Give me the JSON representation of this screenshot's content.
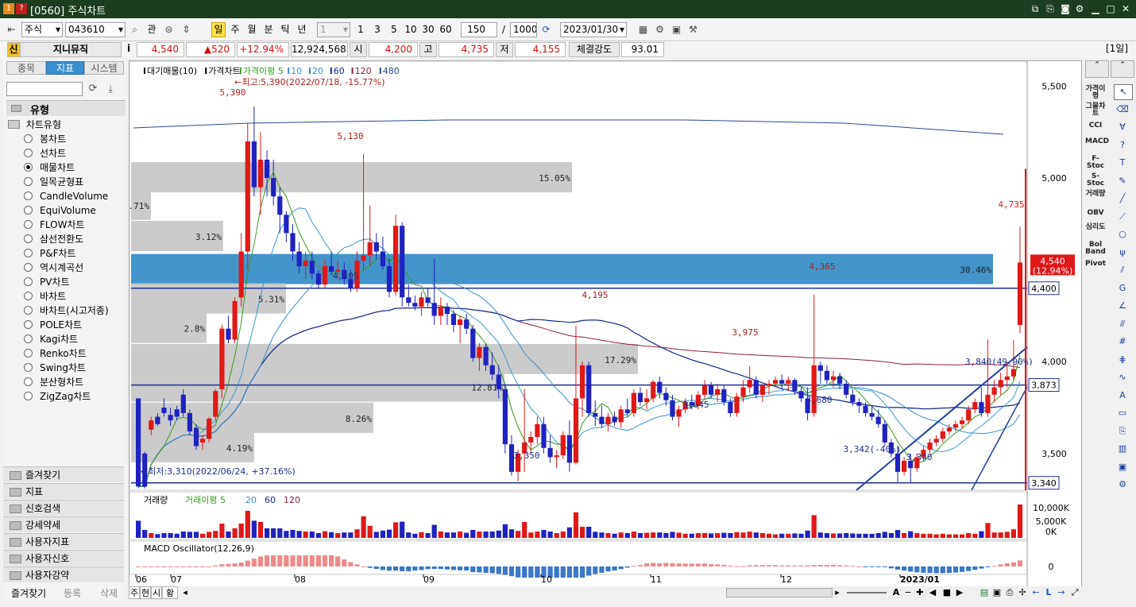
{
  "window": {
    "title": "[0560] 주식차트",
    "icon_1": "1",
    "icon_2": "?"
  },
  "toolbar": {
    "market": "주식",
    "code": "043610",
    "btn_watch": "관",
    "periods": [
      "일",
      "주",
      "월",
      "분",
      "틱",
      "년"
    ],
    "interval_value": "1",
    "quick_intervals": [
      "1",
      "3",
      "5",
      "10",
      "30",
      "60"
    ],
    "count": "150",
    "separator": "/",
    "max_count": "1000",
    "date": "2023/01/30"
  },
  "price_row": {
    "badge": "신",
    "name": "지니뮤직",
    "info": "i",
    "price": "4,540",
    "change": "▲520",
    "change_pct": "+12.94%",
    "volume": "12,924,568",
    "open_label": "시",
    "open": "4,200",
    "high_label": "고",
    "high": "4,735",
    "low_label": "저",
    "low": "4,155",
    "strength_label": "체결강도",
    "strength": "93.01",
    "period_tag": "[1일]"
  },
  "left_panel": {
    "tabs": [
      "종목",
      "지표",
      "시스템"
    ],
    "section_title": "유형",
    "group_title": "차트유형",
    "chart_types": [
      "봉차트",
      "선차트",
      "매물차트",
      "일목균형표",
      "CandleVolume",
      "EquiVolume",
      "FLOW차트",
      "삼선전환도",
      "P&F차트",
      "역시계곡선",
      "PV차트",
      "바차트",
      "바차트(시고저종)",
      "POLE차트",
      "Kagi차트",
      "Renko차트",
      "Swing차트",
      "분산형차트",
      "ZigZag차트"
    ],
    "selected_index": 2,
    "accordions": [
      "즐겨찾기",
      "지표",
      "신호검색",
      "강세약세",
      "사용자지표",
      "사용자신호",
      "사용자강약"
    ],
    "footer": [
      "즐겨찾기",
      "등록",
      "삭제"
    ]
  },
  "right_toolbar": {
    "indicator_buttons": [
      "가격이평",
      "그물차트",
      "CCI",
      "MACD",
      "F-Stoc",
      "S-Stoc",
      "거래량",
      "OBV",
      "심리도",
      "Bol Band",
      "Pivot"
    ],
    "tool_icons": [
      "cursor-icon",
      "eraser-icon",
      "all-icon",
      "help-icon",
      "text-icon",
      "pen-icon",
      "line-icon",
      "trendline-icon",
      "circle-icon",
      "fib-icon",
      "channel-icon",
      "gann-icon",
      "angle-icon",
      "parallel-icon",
      "cycle-icon",
      "speed-icon",
      "wave-icon",
      "auto-icon",
      "window-icon",
      "copy-icon",
      "chart-icon",
      "save-icon",
      "setting-icon"
    ]
  },
  "bottom_bar": {
    "tabs": [
      "주",
      "현",
      "시",
      "황"
    ]
  },
  "chart_data": {
    "type": "candlestick",
    "legend_price": [
      "대기매물(10)",
      "가격차트",
      "가격이평 5",
      "10",
      "20",
      "60",
      "120",
      "480"
    ],
    "legend_price_colors": [
      "#000000",
      "#000000",
      "#3a9a20",
      "#3a8fd0",
      "#3a8fd0",
      "#102a8a",
      "#8a2040",
      "#2a4a8a"
    ],
    "legend_volume": [
      "거래량",
      "거래이평 5",
      "20",
      "60",
      "120"
    ],
    "legend_macd": [
      "MACD Oscillator(12,26,9)"
    ],
    "x_labels": [
      "06",
      "07",
      "08",
      "09",
      "10",
      "11",
      "12",
      "2023/01"
    ],
    "y_ticks": [
      "5,500",
      "5,000",
      "4,500",
      "4,000",
      "3,500"
    ],
    "ylim": [
      3300,
      5550
    ],
    "volume_ticks": [
      "10,000K",
      "5,000K",
      "0K"
    ],
    "macd_ticks": [
      "0"
    ],
    "annotations": {
      "high_note": "←최고:5,390(2022/07/18, -15.77%)",
      "low_note": "←최저:3,310(2022/06/24, +37.16%)",
      "peaks": [
        "5,390",
        "5,130",
        "4,405",
        "4,195",
        "3,975",
        "4,365",
        "3,645",
        "3,680",
        "3,350",
        "3,340",
        "3,342(-40%)",
        "4,735"
      ],
      "trend_label": "3,840(49.90%)"
    },
    "volume_profile": [
      {
        "pct": "15.05%",
        "value": 5000
      },
      {
        "pct": "0.71%",
        "value": 4850
      },
      {
        "pct": "3.12%",
        "value": 4680
      },
      {
        "pct": "30.46%",
        "value": 4500
      },
      {
        "pct": "5.31%",
        "value": 4340
      },
      {
        "pct": "2.8%",
        "value": 4180
      },
      {
        "pct": "17.29%",
        "value": 4010
      },
      {
        "pct": "12.81%",
        "value": 3860
      },
      {
        "pct": "8.26%",
        "value": 3690
      },
      {
        "pct": "4.19%",
        "value": 3530
      }
    ],
    "price_tags": [
      {
        "label": "4,540",
        "sub": "(12.94%)",
        "value": 4540,
        "kind": "current"
      },
      {
        "label": "4,400",
        "value": 4400,
        "kind": "line"
      },
      {
        "label": "3,873",
        "value": 3873,
        "kind": "line"
      },
      {
        "label": "3,340",
        "value": 3340,
        "kind": "line"
      }
    ],
    "candles": [
      [
        3800,
        3800,
        3310,
        3320
      ],
      [
        3500,
        3510,
        3310,
        3320
      ],
      [
        3630,
        3700,
        3600,
        3680
      ],
      [
        3700,
        3720,
        3650,
        3660
      ],
      [
        3750,
        3800,
        3700,
        3720
      ],
      [
        3710,
        3750,
        3650,
        3680
      ],
      [
        3740,
        3760,
        3680,
        3700
      ],
      [
        3820,
        3850,
        3700,
        3720
      ],
      [
        3720,
        3740,
        3600,
        3620
      ],
      [
        3640,
        3660,
        3520,
        3540
      ],
      [
        3560,
        3600,
        3520,
        3580
      ],
      [
        3580,
        3700,
        3560,
        3690
      ],
      [
        3700,
        3850,
        3680,
        3840
      ],
      [
        3850,
        4200,
        3800,
        4180
      ],
      [
        4180,
        4250,
        4100,
        4120
      ],
      [
        4120,
        4350,
        4100,
        4330
      ],
      [
        4350,
        4700,
        4300,
        4600
      ],
      [
        4600,
        5300,
        4500,
        5200
      ],
      [
        5200,
        5390,
        4900,
        4950
      ],
      [
        4950,
        5250,
        4800,
        5100
      ],
      [
        5100,
        5150,
        4900,
        5000
      ],
      [
        5000,
        5100,
        4850,
        4900
      ],
      [
        4900,
        4950,
        4700,
        4800
      ],
      [
        4800,
        4820,
        4650,
        4700
      ],
      [
        4700,
        4750,
        4550,
        4600
      ],
      [
        4600,
        4650,
        4480,
        4520
      ],
      [
        4520,
        4600,
        4450,
        4550
      ],
      [
        4550,
        4600,
        4450,
        4480
      ],
      [
        4480,
        4500,
        4400,
        4420
      ],
      [
        4420,
        4560,
        4400,
        4520
      ],
      [
        4520,
        4600,
        4470,
        4490
      ],
      [
        4490,
        4550,
        4450,
        4500
      ],
      [
        4500,
        4540,
        4420,
        4450
      ],
      [
        4450,
        4500,
        4380,
        4400
      ],
      [
        4400,
        4600,
        4380,
        4550
      ],
      [
        4550,
        5130,
        4500,
        4580
      ],
      [
        4580,
        4850,
        4520,
        4650
      ],
      [
        4650,
        4700,
        4560,
        4600
      ],
      [
        4600,
        4680,
        4500,
        4520
      ],
      [
        4520,
        4560,
        4350,
        4380
      ],
      [
        4380,
        4800,
        4360,
        4740
      ],
      [
        4740,
        4760,
        4300,
        4350
      ],
      [
        4350,
        4420,
        4300,
        4320
      ],
      [
        4320,
        4360,
        4280,
        4300
      ],
      [
        4300,
        4380,
        4250,
        4350
      ],
      [
        4350,
        4400,
        4300,
        4320
      ],
      [
        4320,
        4560,
        4200,
        4250
      ],
      [
        4250,
        4350,
        4200,
        4300
      ],
      [
        4300,
        4320,
        4200,
        4260
      ],
      [
        4260,
        4280,
        4160,
        4200
      ],
      [
        4200,
        4250,
        4100,
        4230
      ],
      [
        4230,
        4260,
        4150,
        4180
      ],
      [
        4180,
        4200,
        4000,
        4020
      ],
      [
        4020,
        4100,
        3950,
        4080
      ],
      [
        4080,
        4100,
        3950,
        3980
      ],
      [
        3980,
        4050,
        3900,
        3930
      ],
      [
        3930,
        3980,
        3800,
        3850
      ],
      [
        3850,
        3880,
        3500,
        3550
      ],
      [
        3550,
        3600,
        3380,
        3400
      ],
      [
        3400,
        3520,
        3350,
        3500
      ],
      [
        3500,
        3850,
        3400,
        3560
      ],
      [
        3560,
        3620,
        3500,
        3590
      ],
      [
        3590,
        3700,
        3550,
        3660
      ],
      [
        3660,
        3700,
        3500,
        3530
      ],
      [
        3530,
        3600,
        3450,
        3480
      ],
      [
        3480,
        3520,
        3420,
        3490
      ],
      [
        3490,
        3620,
        3470,
        3600
      ],
      [
        3600,
        3680,
        3400,
        3450
      ],
      [
        3450,
        4195,
        3440,
        3800
      ],
      [
        3800,
        4000,
        3700,
        3980
      ],
      [
        3980,
        4000,
        3700,
        3720
      ],
      [
        3720,
        3790,
        3650,
        3700
      ],
      [
        3700,
        3760,
        3640,
        3660
      ],
      [
        3660,
        3720,
        3620,
        3700
      ],
      [
        3700,
        3730,
        3650,
        3670
      ],
      [
        3670,
        3760,
        3640,
        3740
      ],
      [
        3740,
        3800,
        3700,
        3720
      ],
      [
        3720,
        3850,
        3700,
        3830
      ],
      [
        3830,
        3860,
        3760,
        3780
      ],
      [
        3780,
        3850,
        3740,
        3800
      ],
      [
        3800,
        3900,
        3780,
        3890
      ],
      [
        3890,
        3920,
        3800,
        3830
      ],
      [
        3830,
        3860,
        3760,
        3790
      ],
      [
        3790,
        3820,
        3680,
        3700
      ],
      [
        3700,
        3760,
        3645,
        3740
      ],
      [
        3740,
        3800,
        3720,
        3780
      ],
      [
        3780,
        3820,
        3740,
        3760
      ],
      [
        3760,
        3840,
        3740,
        3820
      ],
      [
        3820,
        3900,
        3800,
        3870
      ],
      [
        3870,
        3890,
        3800,
        3820
      ],
      [
        3820,
        3880,
        3780,
        3850
      ],
      [
        3850,
        3870,
        3760,
        3780
      ],
      [
        3780,
        3800,
        3700,
        3720
      ],
      [
        3720,
        3830,
        3700,
        3810
      ],
      [
        3810,
        3900,
        3780,
        3860
      ],
      [
        3860,
        3975,
        3830,
        3900
      ],
      [
        3900,
        3920,
        3800,
        3820
      ],
      [
        3820,
        3880,
        3780,
        3870
      ],
      [
        3870,
        3900,
        3820,
        3880
      ],
      [
        3880,
        3920,
        3860,
        3900
      ],
      [
        3900,
        3930,
        3850,
        3880
      ],
      [
        3880,
        3920,
        3840,
        3900
      ],
      [
        3900,
        3910,
        3820,
        3840
      ],
      [
        3840,
        3860,
        3780,
        3800
      ],
      [
        3800,
        3860,
        3680,
        3720
      ],
      [
        3720,
        4365,
        3700,
        3980
      ],
      [
        3980,
        4000,
        3880,
        3950
      ],
      [
        3950,
        3980,
        3880,
        3900
      ],
      [
        3900,
        3950,
        3860,
        3920
      ],
      [
        3920,
        3940,
        3850,
        3880
      ],
      [
        3880,
        3900,
        3800,
        3820
      ],
      [
        3820,
        3850,
        3760,
        3780
      ],
      [
        3780,
        3800,
        3720,
        3760
      ],
      [
        3760,
        3780,
        3700,
        3720
      ],
      [
        3720,
        3760,
        3680,
        3700
      ],
      [
        3700,
        3740,
        3640,
        3660
      ],
      [
        3660,
        3680,
        3540,
        3560
      ],
      [
        3560,
        3580,
        3480,
        3500
      ],
      [
        3500,
        3540,
        3342,
        3400
      ],
      [
        3400,
        3480,
        3380,
        3460
      ],
      [
        3460,
        3500,
        3340,
        3420
      ],
      [
        3420,
        3500,
        3400,
        3480
      ],
      [
        3480,
        3540,
        3460,
        3520
      ],
      [
        3520,
        3580,
        3500,
        3560
      ],
      [
        3560,
        3600,
        3540,
        3580
      ],
      [
        3580,
        3640,
        3560,
        3620
      ],
      [
        3620,
        3660,
        3600,
        3640
      ],
      [
        3640,
        3680,
        3620,
        3660
      ],
      [
        3660,
        3700,
        3640,
        3680
      ],
      [
        3680,
        3760,
        3660,
        3740
      ],
      [
        3740,
        3800,
        3720,
        3780
      ],
      [
        3780,
        3860,
        3700,
        3720
      ],
      [
        3720,
        4120,
        3700,
        3820
      ],
      [
        3820,
        3900,
        3780,
        3860
      ],
      [
        3860,
        3940,
        3820,
        3900
      ],
      [
        3900,
        4000,
        3860,
        3920
      ],
      [
        3920,
        4120,
        3900,
        3960
      ],
      [
        4200,
        4735,
        4155,
        4540
      ]
    ]
  }
}
